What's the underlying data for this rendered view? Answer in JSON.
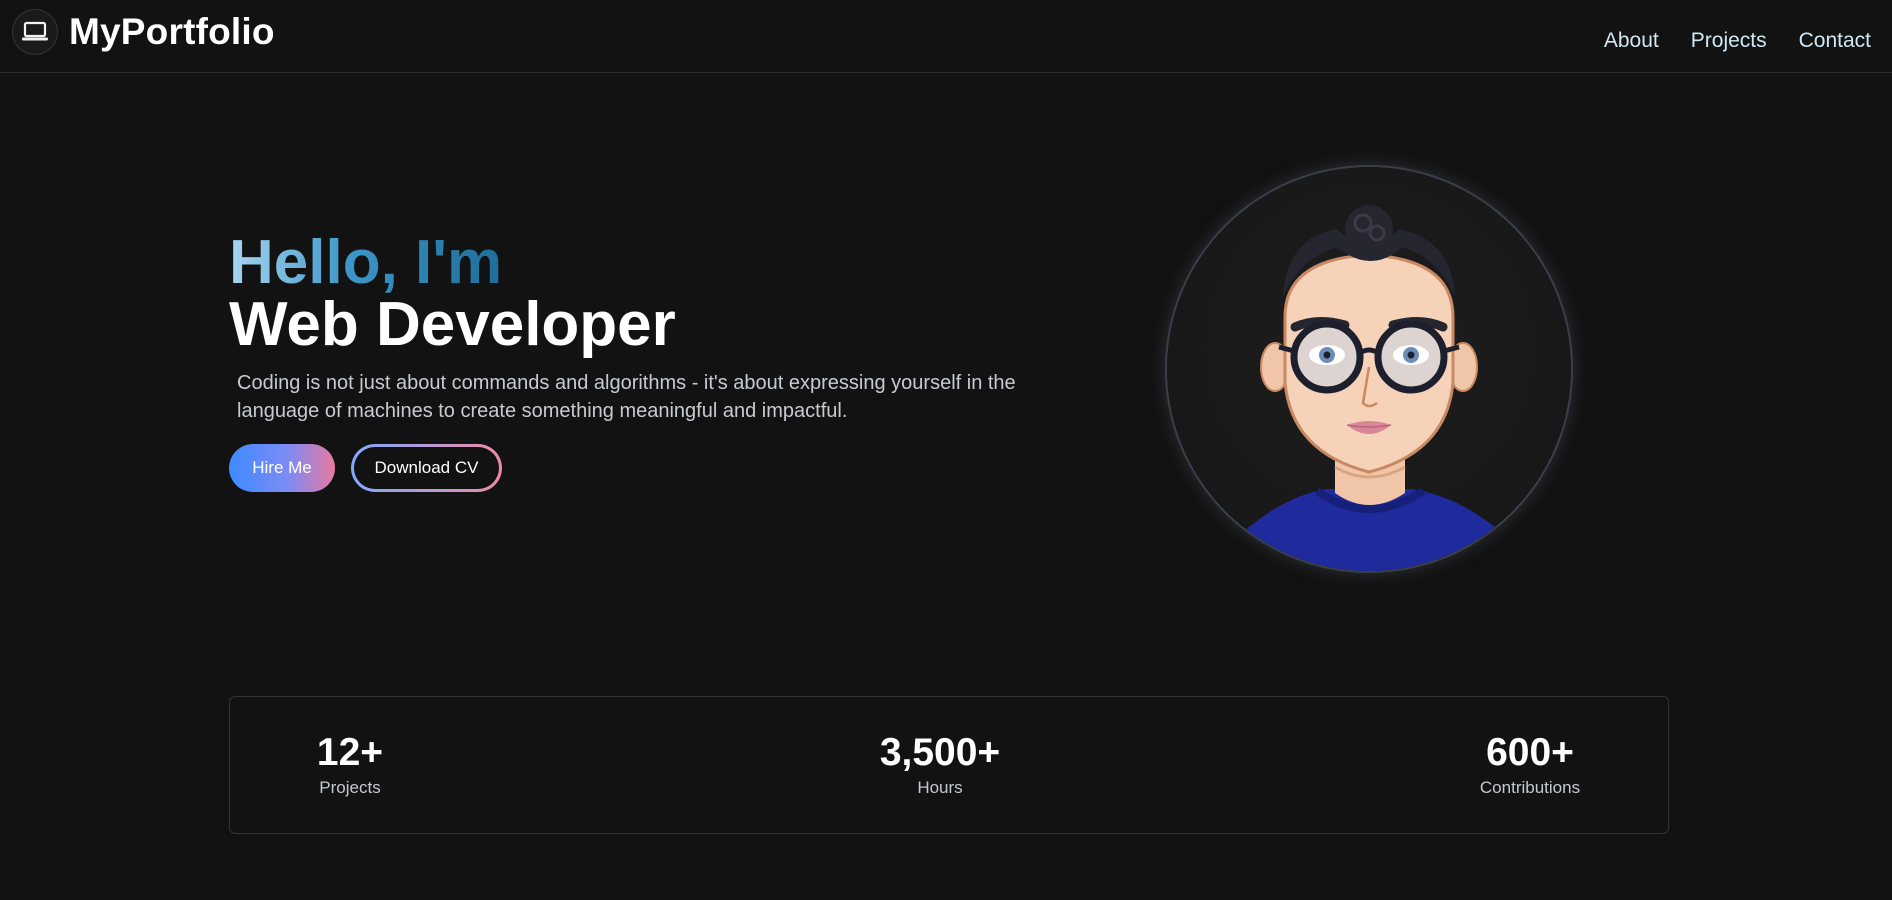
{
  "brand": {
    "name": "MyPortfolio",
    "icon": "laptop-icon"
  },
  "nav": {
    "items": [
      "About",
      "Projects",
      "Contact"
    ]
  },
  "hero": {
    "greeting": "Hello, I'm",
    "title": "Web Developer",
    "description": "Coding is not just about commands and algorithms - it's about expressing yourself in the language of machines to create something meaningful and impactful.",
    "hire_label": "Hire Me",
    "cv_label": "Download CV"
  },
  "stats": [
    {
      "value": "12+",
      "label": "Projects"
    },
    {
      "value": "3,500+",
      "label": "Hours"
    },
    {
      "value": "600+",
      "label": "Contributions"
    }
  ],
  "colors": {
    "background": "#121212",
    "nav_link": "#cfe8f3",
    "greeting_gradient": [
      "#a9d6f0",
      "#1e6e9a"
    ],
    "hire_gradient": [
      "#3d8bff",
      "#e87aa0"
    ]
  }
}
